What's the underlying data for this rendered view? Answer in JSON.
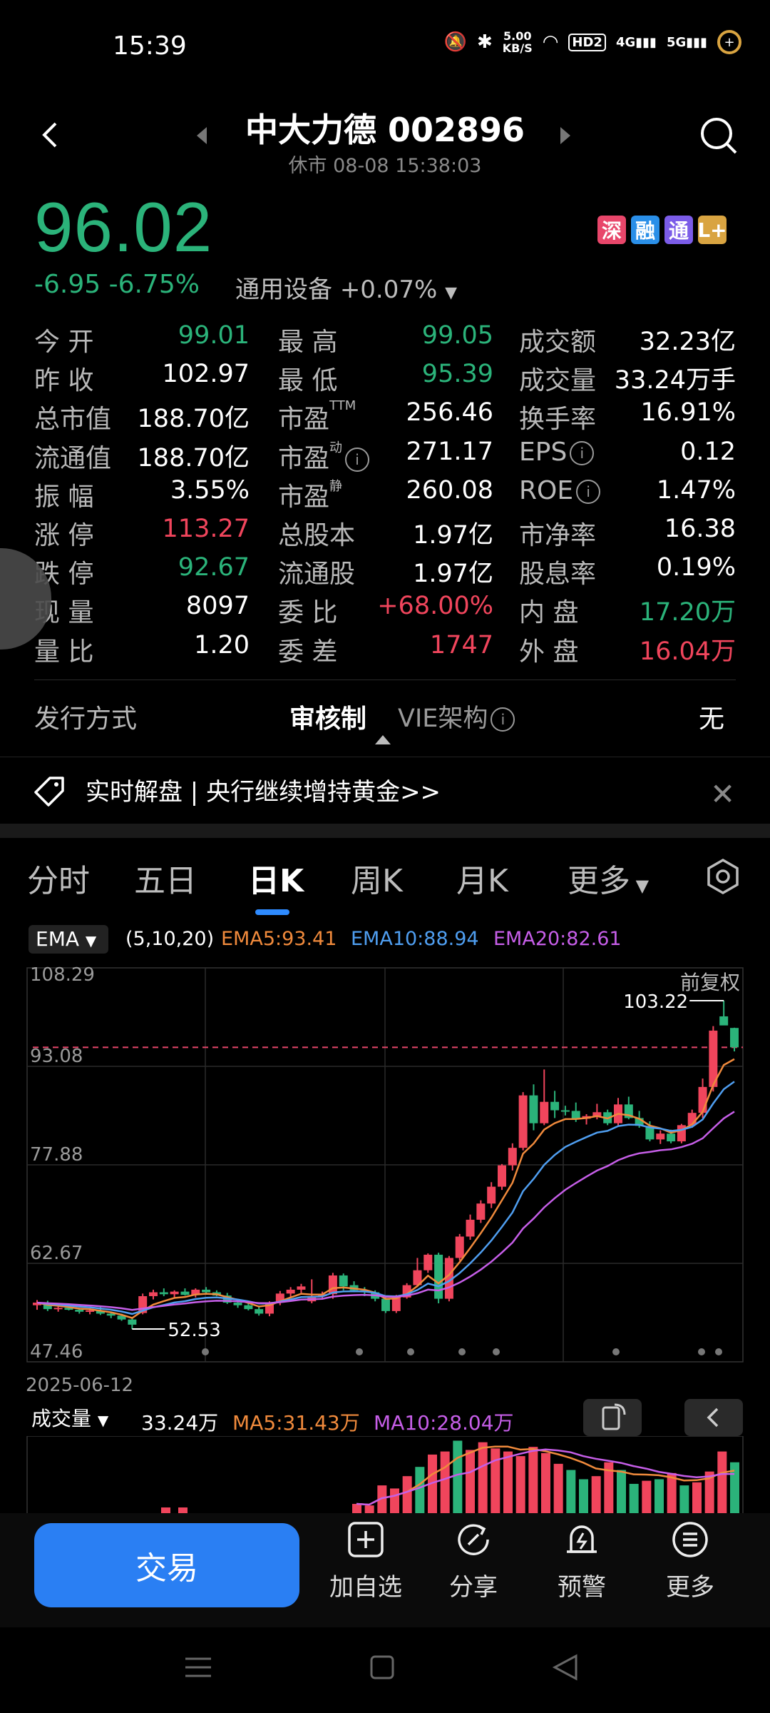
{
  "status_bar": {
    "time": "15:39",
    "speed_top": "5.00",
    "speed_bottom": "KB/S",
    "hd": "HD2",
    "net1": "4G",
    "net2": "5G"
  },
  "header": {
    "title": "中大力德 002896",
    "subtitle": "休市  08-08 15:38:03"
  },
  "quote": {
    "price": "96.02",
    "change": "-6.95  -6.75%",
    "sector": "通用设备",
    "sector_change": "+0.07%",
    "tags": [
      {
        "text": "深",
        "color": "#e8466a"
      },
      {
        "text": "融",
        "color": "#2a8fe8"
      },
      {
        "text": "通",
        "color": "#7b5ce8"
      },
      {
        "text": "L+",
        "color": "#d9a441"
      }
    ]
  },
  "stats": {
    "col1": [
      {
        "label": "今    开",
        "value": "99.01",
        "color": "green"
      },
      {
        "label": "昨    收",
        "value": "102.97",
        "color": "white"
      },
      {
        "label": "总市值",
        "value": "188.70亿",
        "color": "white"
      },
      {
        "label": "流通值",
        "value": "188.70亿",
        "color": "white"
      },
      {
        "label": "振    幅",
        "value": "3.55%",
        "color": "white"
      },
      {
        "label": "涨    停",
        "value": "113.27",
        "color": "red"
      },
      {
        "label": "跌    停",
        "value": "92.67",
        "color": "green"
      },
      {
        "label": "现    量",
        "value": "8097",
        "color": "white"
      },
      {
        "label": "量    比",
        "value": "1.20",
        "color": "white"
      }
    ],
    "col2": [
      {
        "label": "最    高",
        "value": "99.05",
        "color": "green"
      },
      {
        "label": "最    低",
        "value": "95.39",
        "color": "green"
      },
      {
        "label": "市盈",
        "sup": "TTM",
        "value": "256.46",
        "color": "white"
      },
      {
        "label": "市盈",
        "sup": "动",
        "info": true,
        "value": "271.17",
        "color": "white"
      },
      {
        "label": "市盈",
        "sup": "静",
        "value": "260.08",
        "color": "white"
      },
      {
        "label": "总股本",
        "value": "1.97亿",
        "color": "white"
      },
      {
        "label": "流通股",
        "value": "1.97亿",
        "color": "white"
      },
      {
        "label": "委    比",
        "value": "+68.00%",
        "color": "red"
      },
      {
        "label": "委    差",
        "value": "1747",
        "color": "red"
      }
    ],
    "col3": [
      {
        "label": "成交额",
        "value": "32.23亿",
        "color": "white"
      },
      {
        "label": "成交量",
        "value": "33.24万手",
        "color": "white"
      },
      {
        "label": "换手率",
        "value": "16.91%",
        "color": "white"
      },
      {
        "label": "EPS",
        "info": true,
        "value": "0.12",
        "color": "white"
      },
      {
        "label": "ROE",
        "info": true,
        "value": "1.47%",
        "color": "white"
      },
      {
        "label": "市净率",
        "value": "16.38",
        "color": "white"
      },
      {
        "label": "股息率",
        "value": "0.19%",
        "color": "white"
      },
      {
        "label": "内    盘",
        "value": "17.20万",
        "color": "green"
      },
      {
        "label": "外    盘",
        "value": "16.04万",
        "color": "red"
      }
    ]
  },
  "issue": {
    "label": "发行方式",
    "value": "审核制",
    "vie_label": "VIE架构",
    "vie_value": "无"
  },
  "news": {
    "text": "实时解盘 | 央行继续增持黄金>>"
  },
  "tabs": [
    {
      "label": "分时",
      "active": false
    },
    {
      "label": "五日",
      "active": false
    },
    {
      "label": "日K",
      "active": true
    },
    {
      "label": "周K",
      "active": false
    },
    {
      "label": "月K",
      "active": false
    },
    {
      "label": "更多",
      "active": false
    }
  ],
  "ema": {
    "selector": "EMA",
    "params": "(5,10,20)",
    "ema5": "EMA5:93.41",
    "ema10": "EMA10:88.94",
    "ema20": "EMA20:82.61"
  },
  "chart_labels": {
    "adjust": "前复权",
    "high_marker": "103.22",
    "low_marker": "52.53",
    "start_date": "2025-06-12"
  },
  "volume": {
    "selector": "成交量",
    "value": "33.24万",
    "ma5": "MA5:31.43万",
    "ma10": "MA10:28.04万"
  },
  "bottom": {
    "trade": "交易",
    "add": "加自选",
    "share": "分享",
    "alert": "预警",
    "more": "更多"
  },
  "colors": {
    "up": "#f0455c",
    "down": "#2bb37a",
    "accent": "#2a7ff3",
    "ema5": "#f08a3c",
    "ema10": "#4f9ef0",
    "ema20": "#c65ee8"
  },
  "chart_data": {
    "type": "candlestick",
    "y_ticks": [
      "108.29",
      "93.08",
      "77.88",
      "62.67",
      "47.46"
    ],
    "ylim": [
      47.46,
      108.29
    ],
    "reference_line": 96.02,
    "candles": [
      [
        56.2,
        57.0,
        55.5,
        56.6
      ],
      [
        56.6,
        56.9,
        55.3,
        55.6
      ],
      [
        55.6,
        56.1,
        55.2,
        55.8
      ],
      [
        55.8,
        56.3,
        55.4,
        55.5
      ],
      [
        55.5,
        55.8,
        54.9,
        55.2
      ],
      [
        55.2,
        55.7,
        54.8,
        55.4
      ],
      [
        55.4,
        56.0,
        54.7,
        54.9
      ],
      [
        54.9,
        55.2,
        54.2,
        54.6
      ],
      [
        54.6,
        54.9,
        53.8,
        54.0
      ],
      [
        54.0,
        54.3,
        52.53,
        53.2
      ],
      [
        55.0,
        58.0,
        54.8,
        57.6
      ],
      [
        57.6,
        58.6,
        57.1,
        58.2
      ],
      [
        58.2,
        58.8,
        57.6,
        57.9
      ],
      [
        57.9,
        58.5,
        57.3,
        58.3
      ],
      [
        58.3,
        58.8,
        57.7,
        57.8
      ],
      [
        57.8,
        58.8,
        57.4,
        58.6
      ],
      [
        58.6,
        59.0,
        58.0,
        58.2
      ],
      [
        58.2,
        58.5,
        57.6,
        57.7
      ],
      [
        57.7,
        58.1,
        56.4,
        56.6
      ],
      [
        56.6,
        57.0,
        55.8,
        56.2
      ],
      [
        56.2,
        56.8,
        55.4,
        55.6
      ],
      [
        55.6,
        56.0,
        54.6,
        54.9
      ],
      [
        54.9,
        56.8,
        54.5,
        56.6
      ],
      [
        56.6,
        58.4,
        56.2,
        58.0
      ],
      [
        58.0,
        59.0,
        57.5,
        58.6
      ],
      [
        58.6,
        59.5,
        58.1,
        59.1
      ],
      [
        56.8,
        60.2,
        56.5,
        57.6
      ],
      [
        57.6,
        58.3,
        57.1,
        57.9
      ],
      [
        57.9,
        61.2,
        57.2,
        60.8
      ],
      [
        60.8,
        61.1,
        58.5,
        59.1
      ],
      [
        59.3,
        59.9,
        58.2,
        58.5
      ],
      [
        58.5,
        59.0,
        57.6,
        58.2
      ],
      [
        58.2,
        58.5,
        56.8,
        57.2
      ],
      [
        57.2,
        57.7,
        55.0,
        55.3
      ],
      [
        55.3,
        57.8,
        55.0,
        57.4
      ],
      [
        57.4,
        59.6,
        57.2,
        59.3
      ],
      [
        59.3,
        63.5,
        59.0,
        61.6
      ],
      [
        61.6,
        64.2,
        61.2,
        64.0
      ],
      [
        64.0,
        64.3,
        56.5,
        57.2
      ],
      [
        57.2,
        63.8,
        56.8,
        63.5
      ],
      [
        63.5,
        67.2,
        63.1,
        66.8
      ],
      [
        66.8,
        70.2,
        66.3,
        69.4
      ],
      [
        69.4,
        72.4,
        68.9,
        71.9
      ],
      [
        71.9,
        75.2,
        71.2,
        74.5
      ],
      [
        74.5,
        78.0,
        74.0,
        77.8
      ],
      [
        77.8,
        81.2,
        77.0,
        80.5
      ],
      [
        80.5,
        89.1,
        80.1,
        88.6
      ],
      [
        88.6,
        90.3,
        83.2,
        84.3
      ],
      [
        84.3,
        92.6,
        84.0,
        87.6
      ],
      [
        87.6,
        89.3,
        85.1,
        86.3
      ],
      [
        86.3,
        87.0,
        85.5,
        86.2
      ],
      [
        86.2,
        87.5,
        84.5,
        85.0
      ],
      [
        85.0,
        85.7,
        84.1,
        85.4
      ],
      [
        85.4,
        87.3,
        84.9,
        86.0
      ],
      [
        86.0,
        86.4,
        84.0,
        84.3
      ],
      [
        84.3,
        88.2,
        84.0,
        87.2
      ],
      [
        87.2,
        88.4,
        84.9,
        85.1
      ],
      [
        85.1,
        86.2,
        83.6,
        83.9
      ],
      [
        83.9,
        84.6,
        81.5,
        81.8
      ],
      [
        81.8,
        83.2,
        81.1,
        82.7
      ],
      [
        82.7,
        83.3,
        81.2,
        81.5
      ],
      [
        81.5,
        84.2,
        81.2,
        84.0
      ],
      [
        84.0,
        86.4,
        83.6,
        85.9
      ],
      [
        85.9,
        91.2,
        85.1,
        89.9
      ],
      [
        89.9,
        99.3,
        89.2,
        98.6
      ],
      [
        100.8,
        103.22,
        99.6,
        99.4
      ],
      [
        99.01,
        99.05,
        95.39,
        96.02
      ]
    ],
    "ema5_last": 93.41,
    "ema10_last": 88.94,
    "ema20_last": 82.61,
    "volume": [
      {
        "v": 6,
        "up": true
      },
      {
        "v": 5,
        "up": true
      },
      {
        "v": 18,
        "up": true
      },
      {
        "v": 16,
        "up": true
      },
      {
        "v": 24,
        "up": true
      },
      {
        "v": 30,
        "up": false
      },
      {
        "v": 38,
        "up": true
      },
      {
        "v": 40,
        "up": true
      },
      {
        "v": 47,
        "up": false
      },
      {
        "v": 41,
        "up": true
      },
      {
        "v": 46,
        "up": true
      },
      {
        "v": 42,
        "up": true
      },
      {
        "v": 40,
        "up": true
      },
      {
        "v": 37,
        "up": true
      },
      {
        "v": 43,
        "up": true
      },
      {
        "v": 39,
        "up": true
      },
      {
        "v": 32,
        "up": true
      },
      {
        "v": 28,
        "up": false
      },
      {
        "v": 22,
        "up": false
      },
      {
        "v": 24,
        "up": true
      },
      {
        "v": 33,
        "up": true
      },
      {
        "v": 28,
        "up": false
      },
      {
        "v": 19,
        "up": false
      },
      {
        "v": 21,
        "up": true
      },
      {
        "v": 22,
        "up": false
      },
      {
        "v": 26,
        "up": true
      },
      {
        "v": 18,
        "up": false
      },
      {
        "v": 20,
        "up": true
      },
      {
        "v": 27,
        "up": true
      },
      {
        "v": 40,
        "up": true
      },
      {
        "v": 33,
        "up": false
      }
    ]
  }
}
